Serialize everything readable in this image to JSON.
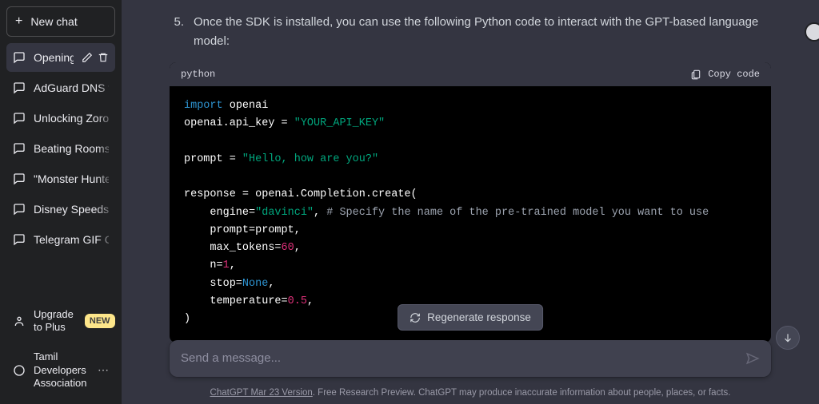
{
  "sidebar": {
    "new_chat_label": "New chat",
    "conversations": [
      {
        "label": "Opening",
        "active": true
      },
      {
        "label": "AdGuard DNS for"
      },
      {
        "label": "Unlocking Zoro's"
      },
      {
        "label": "Beating Rooms a"
      },
      {
        "label": "\"Monster Hunter"
      },
      {
        "label": "Disney Speedsto"
      },
      {
        "label": "Telegram GIF Cr"
      }
    ],
    "upgrade_label": "Upgrade to Plus",
    "upgrade_badge": "NEW",
    "account_label": "Tamil Developers Association"
  },
  "step": {
    "number": "5.",
    "text": "Once the SDK is installed, you can use the following Python code to interact with the GPT-based language model:"
  },
  "codeblock": {
    "language": "python",
    "copy_label": "Copy code",
    "code_lines": [
      [
        {
          "t": "import ",
          "c": "tok-kw"
        },
        {
          "t": "openai"
        }
      ],
      [
        {
          "t": "openai.api_key = "
        },
        {
          "t": "\"YOUR_API_KEY\"",
          "c": "tok-str"
        }
      ],
      [
        {
          "t": ""
        }
      ],
      [
        {
          "t": "prompt = "
        },
        {
          "t": "\"Hello, how are you?\"",
          "c": "tok-str"
        }
      ],
      [
        {
          "t": ""
        }
      ],
      [
        {
          "t": "response = openai.Completion.create("
        }
      ],
      [
        {
          "t": "    engine="
        },
        {
          "t": "\"davinci\"",
          "c": "tok-str"
        },
        {
          "t": ", "
        },
        {
          "t": "# Specify the name of the pre-trained model you want to use",
          "c": "tok-cmt"
        }
      ],
      [
        {
          "t": "    prompt=prompt,"
        }
      ],
      [
        {
          "t": "    max_tokens="
        },
        {
          "t": "60",
          "c": "tok-num"
        },
        {
          "t": ","
        }
      ],
      [
        {
          "t": "    n="
        },
        {
          "t": "1",
          "c": "tok-num"
        },
        {
          "t": ","
        }
      ],
      [
        {
          "t": "    stop="
        },
        {
          "t": "None",
          "c": "tok-const"
        },
        {
          "t": ","
        }
      ],
      [
        {
          "t": "    temperature="
        },
        {
          "t": "0.5",
          "c": "tok-num"
        },
        {
          "t": ","
        }
      ],
      [
        {
          "t": ")"
        }
      ]
    ]
  },
  "regen_label": "Regenerate response",
  "input_placeholder": "Send a message...",
  "footer": {
    "version_label": "ChatGPT Mar 23 Version",
    "rest": ". Free Research Preview. ChatGPT may produce inaccurate information about people, places, or facts."
  }
}
